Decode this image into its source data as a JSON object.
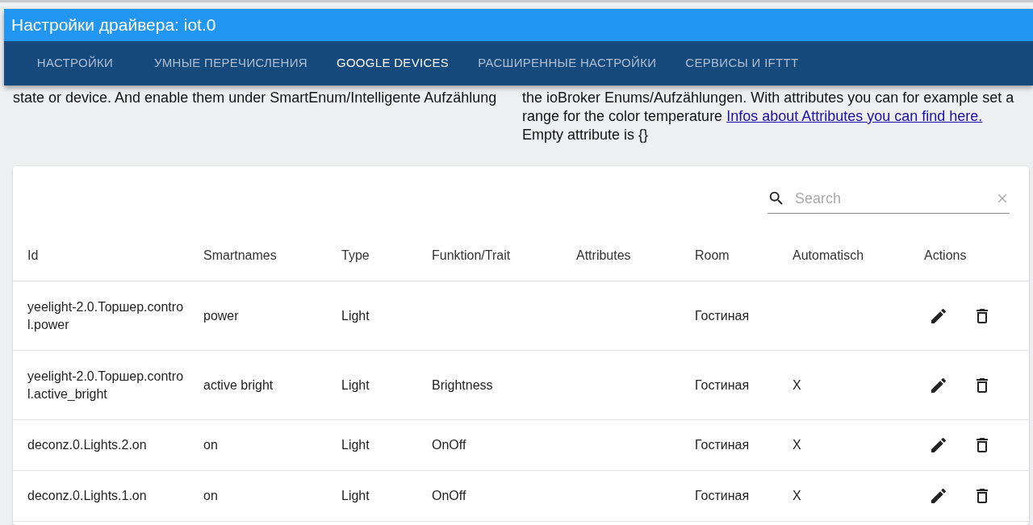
{
  "window": {
    "title": "Настройки драйвера: iot.0"
  },
  "tabs": [
    {
      "label": "НАСТРОЙКИ",
      "selected": false
    },
    {
      "label": "УМНЫЕ ПЕРЕЧИСЛЕНИЯ",
      "selected": false
    },
    {
      "label": "GOOGLE DEVICES",
      "selected": true
    },
    {
      "label": "РАСШИРЕННЫЕ НАСТРОЙКИ",
      "selected": false
    },
    {
      "label": "СЕРВИСЫ И IFTTT",
      "selected": false
    }
  ],
  "description": {
    "left": "state or device. And enable them under SmartEnum/Intelligente Aufzählung",
    "right": "the ioBroker Enums/Aufzählungen. With attributes you can for example set a range for the color temperature",
    "link": "Infos about Attributes you can find here.",
    "right_tail": "Empty attribute is {}"
  },
  "search": {
    "placeholder": "Search"
  },
  "table": {
    "columns": [
      "Id",
      "Smartnames",
      "Type",
      "Funktion/Trait",
      "Attributes",
      "Room",
      "Automatisch",
      "Actions"
    ],
    "rows": [
      {
        "id": "yeelight-2.0.Торшер.control.power",
        "smartnames": "power",
        "type": "Light",
        "trait": "",
        "attributes": "",
        "room": "Гостиная",
        "auto": ""
      },
      {
        "id": "yeelight-2.0.Торшер.control.active_bright",
        "smartnames": "active bright",
        "type": "Light",
        "trait": "Brightness",
        "attributes": "",
        "room": "Гостиная",
        "auto": "X"
      },
      {
        "id": "deconz.0.Lights.2.on",
        "smartnames": "on",
        "type": "Light",
        "trait": "OnOff",
        "attributes": "",
        "room": "Гостиная",
        "auto": "X"
      },
      {
        "id": "deconz.0.Lights.1.on",
        "smartnames": "on",
        "type": "Light",
        "trait": "OnOff",
        "attributes": "",
        "room": "Гостиная",
        "auto": "X"
      }
    ]
  }
}
